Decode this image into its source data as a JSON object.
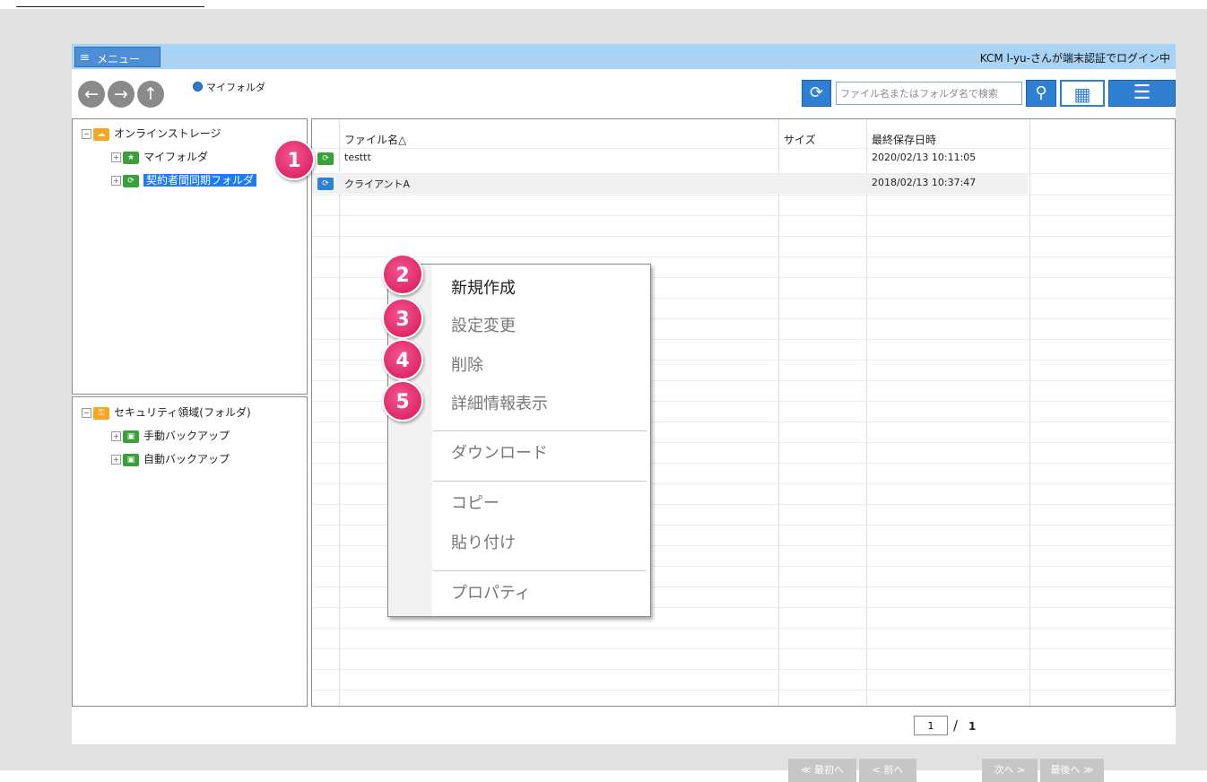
{
  "header": {
    "menu_icon": "≡",
    "menu_label": "メニュー",
    "login_status": "KCM l-yu-さんが端末認証でログイン中"
  },
  "nav": {
    "back_icon": "←",
    "forward_icon": "→",
    "up_icon": "↑",
    "breadcrumb": "マイフォルダ"
  },
  "toolbar": {
    "refresh_icon": "⟳",
    "search_placeholder": "ファイル名またはフォルダ名で検索",
    "search_icon": "⚲",
    "grid_view_icon": "▦",
    "list_view_icon": "☰"
  },
  "tree_top": {
    "root": "オンラインストレージ",
    "items": [
      "マイフォルダ",
      "契約者間同期フォルダ"
    ]
  },
  "tree_bottom": {
    "root": "セキュリティ領域(フォルダ)",
    "items": [
      "手動バックアップ",
      "自動バックアップ"
    ]
  },
  "file_list": {
    "columns": [
      "ファイル名△",
      "サイズ",
      "最終保存日時"
    ],
    "rows": [
      {
        "name": "testtt",
        "size": "",
        "date": "2020/02/13 10:11:05"
      },
      {
        "name": "クライアントA",
        "size": "",
        "date": "2018/02/13 10:37:47"
      }
    ]
  },
  "context_menu": {
    "items": [
      "新規作成",
      "設定変更",
      "削除",
      "詳細情報表示",
      "ダウンロード",
      "コピー",
      "貼り付け",
      "プロパティ"
    ]
  },
  "badges": [
    "1",
    "2",
    "3",
    "4",
    "5"
  ],
  "pagination": {
    "first": "≪ 最初へ",
    "prev": "< 前へ",
    "current_page": "1",
    "separator": "/",
    "total_pages": "1",
    "next": "次へ >",
    "last": "最後へ ≫"
  },
  "colors": {
    "title_bar": "#a9d3f5",
    "accent": "#2f7fd3",
    "selection": "#1d7cf2",
    "badge": "#e21f6a"
  }
}
